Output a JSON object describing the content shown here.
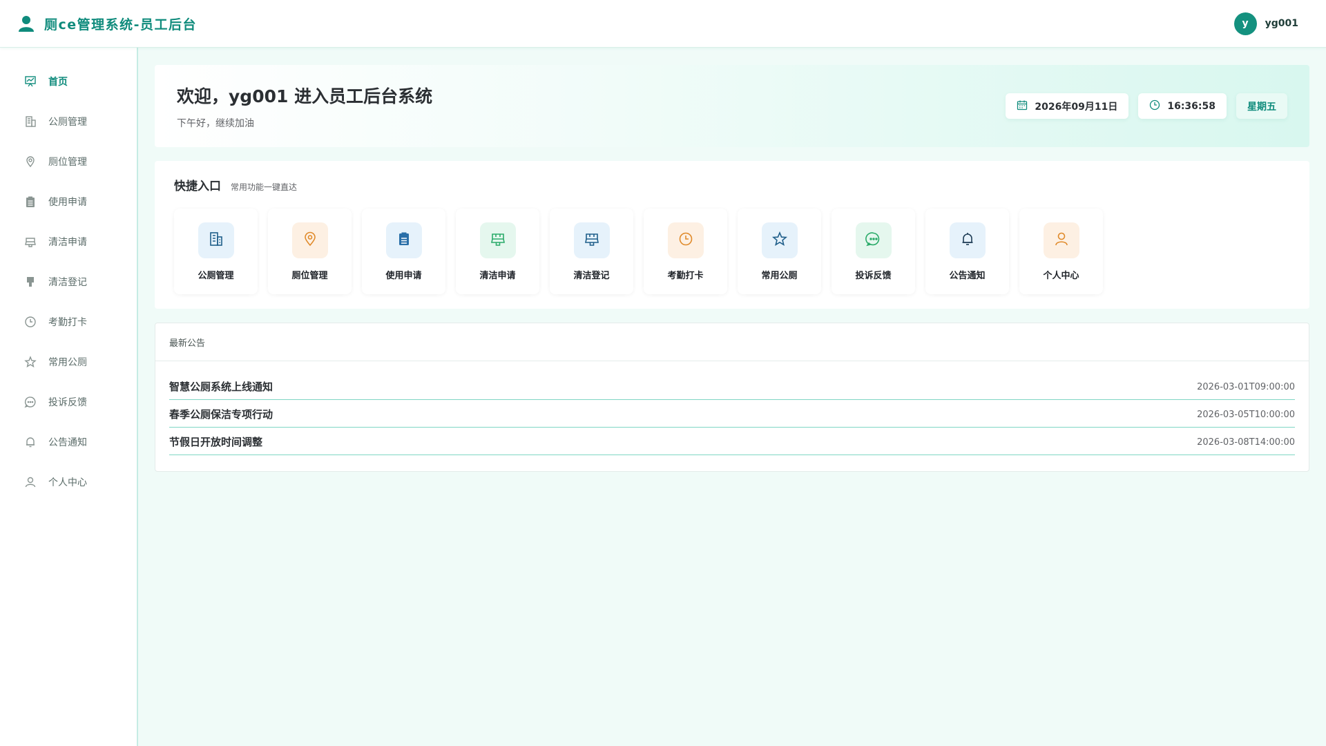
{
  "header": {
    "title": "厕ce管理系统-员工后台",
    "avatar_letter": "y",
    "username": "yg001"
  },
  "sidebar": {
    "items": [
      {
        "label": "首页",
        "icon": "home-chart-icon",
        "active": true
      },
      {
        "label": "公厕管理",
        "icon": "building-icon"
      },
      {
        "label": "厕位管理",
        "icon": "location-pin-icon"
      },
      {
        "label": "使用申请",
        "icon": "clipboard-icon"
      },
      {
        "label": "清洁申请",
        "icon": "brush-icon"
      },
      {
        "label": "清洁登记",
        "icon": "brush-filled-icon"
      },
      {
        "label": "考勤打卡",
        "icon": "clock-icon"
      },
      {
        "label": "常用公厕",
        "icon": "star-icon"
      },
      {
        "label": "投诉反馈",
        "icon": "chat-bubble-icon"
      },
      {
        "label": "公告通知",
        "icon": "bell-icon"
      },
      {
        "label": "个人中心",
        "icon": "user-icon"
      }
    ]
  },
  "welcome": {
    "title": "欢迎，yg001 进入员工后台系统",
    "subtitle": "下午好，继续加油",
    "date": "2026年09月11日",
    "time": "16:36:58",
    "weekday": "星期五"
  },
  "quick": {
    "title": "快捷入口",
    "subtitle": "常用功能一键直达",
    "tiles": [
      {
        "label": "公厕管理",
        "icon": "building-icon",
        "tone": "blue"
      },
      {
        "label": "厕位管理",
        "icon": "location-pin-icon",
        "tone": "orange"
      },
      {
        "label": "使用申请",
        "icon": "clipboard-icon",
        "tone": "blue"
      },
      {
        "label": "清洁申请",
        "icon": "brush-icon",
        "tone": "green"
      },
      {
        "label": "清洁登记",
        "icon": "brush-icon",
        "tone": "blue"
      },
      {
        "label": "考勤打卡",
        "icon": "clock-icon",
        "tone": "orange"
      },
      {
        "label": "常用公厕",
        "icon": "star-icon",
        "tone": "blue"
      },
      {
        "label": "投诉反馈",
        "icon": "chat-bubble-icon",
        "tone": "green"
      },
      {
        "label": "公告通知",
        "icon": "bell-icon",
        "tone": "blue"
      },
      {
        "label": "个人中心",
        "icon": "user-icon",
        "tone": "orange"
      }
    ]
  },
  "notice": {
    "title": "最新公告",
    "items": [
      {
        "title": "智慧公厕系统上线通知",
        "date": "2026-03-01T09:00:00"
      },
      {
        "title": "春季公厕保洁专项行动",
        "date": "2026-03-05T10:00:00"
      },
      {
        "title": "节假日开放时间调整",
        "date": "2026-03-08T14:00:00"
      }
    ]
  },
  "colors": {
    "primary": "#0f8b7c",
    "blue_icon": "#1f5e8a",
    "orange_icon": "#e08a2a",
    "green_icon": "#2bab6a"
  }
}
